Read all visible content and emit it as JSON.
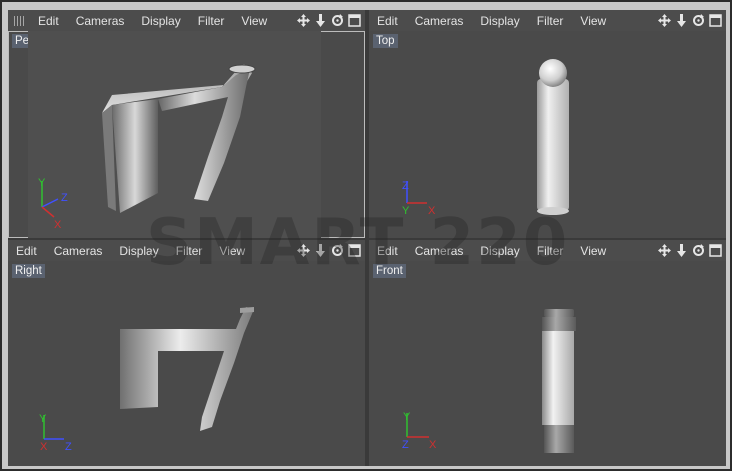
{
  "menu": [
    "Edit",
    "Cameras",
    "Display",
    "Filter",
    "View"
  ],
  "viewports": [
    {
      "label": "Perspective",
      "axes": [
        "Y",
        "Z",
        "X"
      ]
    },
    {
      "label": "Top",
      "axes": [
        "Z",
        "Y",
        "X"
      ]
    },
    {
      "label": "Right",
      "axes": [
        "Y",
        "X",
        "Z"
      ]
    },
    {
      "label": "Front",
      "axes": [
        "Y",
        "Z",
        "X"
      ]
    }
  ],
  "icons": [
    "move-view-icon",
    "zoom-view-icon",
    "rotate-view-icon",
    "maximize-view-icon"
  ],
  "watermark": "SMART 220",
  "colors": {
    "panel": "#4a4a4a",
    "menubar": "#4c4c4c",
    "axis_x": "#d03030",
    "axis_y": "#30c030",
    "axis_z": "#4050ff"
  }
}
